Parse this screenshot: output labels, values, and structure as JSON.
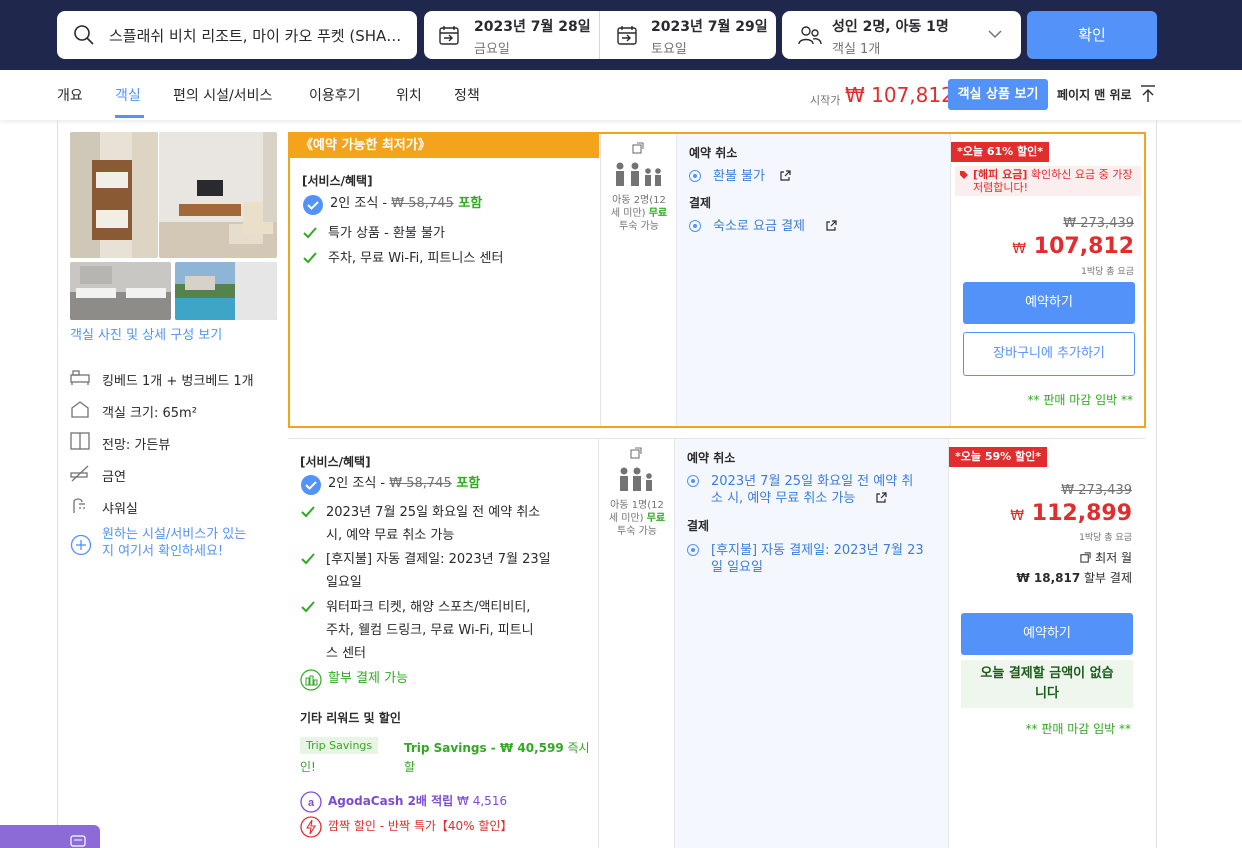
{
  "search": {
    "hotel_query": "스플래쉬 비치 리조트, 마이 카오 푸켓 (SHA Extra Plus)",
    "checkin_date": "2023년 7월 28일",
    "checkin_day": "금요일",
    "checkout_date": "2023년 7월 29일",
    "checkout_day": "토요일",
    "guests": "성인 2명, 아동 1명",
    "rooms": "객실 1개",
    "confirm_label": "확인"
  },
  "nav": {
    "tabs": [
      "개요",
      "객실",
      "편의 시설/서비스",
      "이용후기",
      "위치",
      "정책"
    ],
    "active_tab": "객실",
    "start_from_label": "시작가",
    "start_price": "₩ 107,812",
    "view_rooms_label": "객실 상품 보기",
    "back_to_top_label": "페이지 맨 위로"
  },
  "room": {
    "photos_link": "객실 사진 및 상세 구성 보기",
    "features": [
      "킹베드 1개 + 벙크베드 1개",
      "객실 크기: 65m²",
      "전망: 가든뷰",
      "금연",
      "샤워실"
    ],
    "more_link_line1": "원하는 시설/서비스가 있는",
    "more_link_line2": "지 여기서 확인하세요!"
  },
  "offer1": {
    "badge": "《예약 가능한 최저가》",
    "services_title": "[서비스/혜택]",
    "breakfast_label": "2인 조식 - ",
    "breakfast_old_price": "₩ 58,745",
    "breakfast_included": " 포함",
    "benefit_2": "특가 상품 - 환불 불가",
    "benefit_3": "주차, 무료 Wi-Fi, 피트니스 센터",
    "occupancy_1": "아동 2명(12",
    "occupancy_2": "세 미만)",
    "occupancy_free": "무료",
    "occupancy_3": "투숙 가능",
    "cancel_title": "예약 취소",
    "cancel_value": "환불 불가",
    "payment_title": "결제",
    "payment_value": "숙소로 요금 결제",
    "discount_badge": "*오늘 61% 할인*",
    "happy_rate_1": "[해피 요금]",
    "happy_rate_2": " 확인하신 요금 중 가장 저렴합니다!",
    "old_price": "₩ 273,439",
    "currency": "₩",
    "new_price": "107,812",
    "per_night": "1박당 총 요금",
    "book_label": "예약하기",
    "cart_label": "장바구니에 추가하기",
    "selling_fast": "** 판매 마감 임박 **"
  },
  "offer2": {
    "services_title": "[서비스/혜택]",
    "breakfast_label": "2인 조식 - ",
    "breakfast_old_price": "₩ 58,745",
    "breakfast_included": " 포함",
    "benefit_2_line1": "2023년 7월 25일 화요일 전 예약 취소",
    "benefit_2_line2": "시, 예약 무료 취소 가능",
    "benefit_3_line1": "[후지불] 자동 결제일: 2023년 7월 23일",
    "benefit_3_line2": "일요일",
    "benefit_4_line1": "워터파크 티켓, 해양 스포츠/액티비티,",
    "benefit_4_line2": "주차, 웰컴 드링크, 무료 Wi-Fi, 피트니",
    "benefit_4_line3": "스 센터",
    "installment_label": "할부 결제 가능",
    "other_rewards_title": "기타 리워드 및 할인",
    "trip_savings_badge": "Trip Savings",
    "trip_savings_text": "Trip Savings - ₩ 40,599",
    "trip_savings_suffix": " 즉시 할",
    "trip_savings_suffix2": "인!",
    "agoda_cash": "AgodaCash 2배 적립",
    "agoda_cash_amount": " ₩ 4,516",
    "flash_sale": "깜짝 할인 - 반짝 특가【40% 할인】",
    "occupancy_1": "아동 1명(12",
    "occupancy_2": "세 미만)",
    "occupancy_free": "무료",
    "occupancy_3": "투숙 가능",
    "cancel_title": "예약 취소",
    "cancel_line1": "2023년 7월 25일 화요일 전 예약 취",
    "cancel_line2": "소 시, 예약 무료 취소 가능",
    "payment_title": "결제",
    "payment_line1": "[후지불] 자동 결제일: 2023년 7월 23",
    "payment_line2": "일 일요일",
    "discount_badge": "*오늘 59% 할인*",
    "old_price": "₩ 273,439",
    "currency": "₩",
    "new_price": "112,899",
    "per_night": "1박당 총 요금",
    "installment_max": "최저 월",
    "installment_amount": "₩ 18,817",
    "installment_suffix": " 할부 결제",
    "book_label": "예약하기",
    "no_pay_line1": "오늘 결제할 금액이 없습",
    "no_pay_line2": "니다",
    "selling_fast": "** 판매 마감 임박 **"
  }
}
